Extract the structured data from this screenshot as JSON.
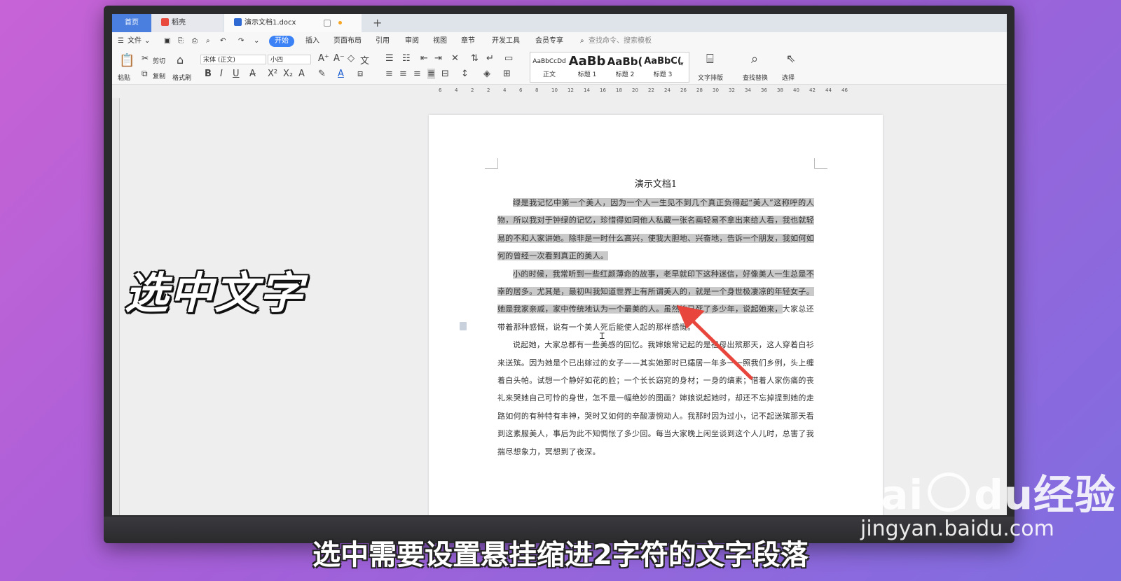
{
  "window": {
    "tabs": [
      {
        "label": "首页"
      },
      {
        "label": "稻壳"
      },
      {
        "label": "演示文档1.docx"
      }
    ],
    "new_tab": "+"
  },
  "menu": {
    "items": [
      "文件",
      "开始",
      "插入",
      "页面布局",
      "引用",
      "审阅",
      "视图",
      "章节",
      "开发工具",
      "会员专享"
    ],
    "search_placeholder": "查找命令、搜索模板"
  },
  "ribbon": {
    "paste": "粘贴",
    "cut": "剪切",
    "copy": "复制",
    "format_painter": "格式刷",
    "font_name": "宋体 (正文)",
    "font_size": "小四",
    "bold": "B",
    "italic": "I",
    "underline": "U",
    "styles": [
      {
        "preview": "AaBbCcDd",
        "label": "正文"
      },
      {
        "preview": "AaBb",
        "label": "标题 1"
      },
      {
        "preview": "AaBb(",
        "label": "标题 2"
      },
      {
        "preview": "AaBbC(",
        "label": "标题 3"
      }
    ],
    "text_layout": "文字排版",
    "find_replace": "查找替换",
    "select": "选择"
  },
  "ruler": [
    "6",
    "4",
    "2",
    "2",
    "4",
    "6",
    "8",
    "10",
    "12",
    "14",
    "16",
    "18",
    "20",
    "22",
    "24",
    "26",
    "28",
    "30",
    "32",
    "34",
    "36",
    "38",
    "40",
    "42",
    "44",
    "46"
  ],
  "document": {
    "title": "演示文档1",
    "paragraphs": [
      "绿是我记忆中第一个美人，因为一个人一生见不到几个真正负得起“美人”这称呼的人物，所以我对于钟绿的记忆，珍惜得如同他人私藏一张名画轻易不拿出来给人看，我也就轻易的不和人家讲她。除非是一时什么高兴，使我大胆地、兴奋地，告诉一个朋友，我如何如何的曾经一次看到真正的美人。",
      "小的时候，我常听到一些红颜薄命的故事，老早就印下这种迷信，好像美人一生总是不幸的居多。尤其是，最初叫我知道世界上有所谓美人的，就是一个身世极凄凉的年轻女子。她是我家亲戚，家中传统地认为一个最美的人。虽然她已死了多少年，说起她来，",
      "大家总还带着那种感慨，说有一个美人死后能使人起的那样感慨。",
      "说起她，大家总都有一些美感的回忆。我婶娘常记起的是祖母出殡那天，这人穿着白衫来送殡。因为她是个已出嫁过的女子——其实她那时已孀居一年多一一照我们乡例，头上缠着白头帕。试想一个静好如花的脸；一个长长窈窕的身材；一身的缟素；借着人家伤痛的丧礼来哭她自己可怜的身世，怎不是一幅绝妙的图画？婶娘说起她时，却还不忘掉提到她的走路如何的有种特有丰神，哭时又如何的辛酸凄惋动人。我那时因为过小，记不起送殡那天看到这素服美人，事后为此不知惆怅了多少回。每当大家晚上闲坐谈到这个人儿时，总害了我揣尽想象力，冥想到了夜深。"
    ]
  },
  "overlay": {
    "step_title": "选中文字",
    "subtitle": "选中需要设置悬挂缩进2字符的文字段落"
  },
  "watermark": {
    "brand_left": "Bai",
    "brand_mid": "du",
    "brand_right": "经验",
    "url": "jingyan.baidu.com"
  },
  "colors": {
    "accent": "#3b82f6",
    "selection": "#c9c9c9",
    "arrow": "#e8453c"
  }
}
